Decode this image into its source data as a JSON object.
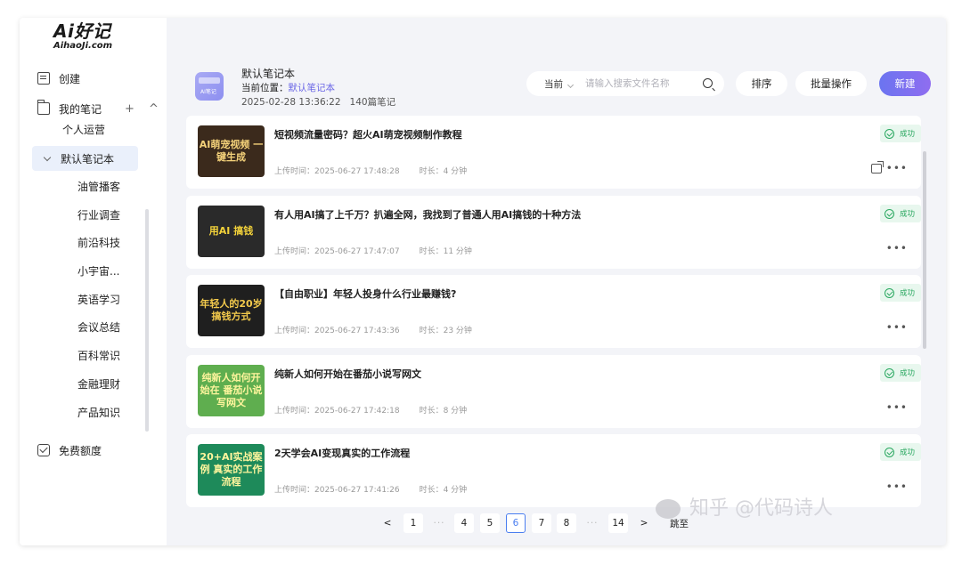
{
  "logo": {
    "main": "Ai好记",
    "sub": "AihaoJi.com"
  },
  "sidebar": {
    "create_label": "创建",
    "my_notes_label": "我的笔记",
    "my_notes_actions": "+ ^",
    "personal_ops": "个人运营",
    "default_notebook": "默认笔记本",
    "leaves": [
      "油管播客",
      "行业调查",
      "前沿科技",
      "小宇宙...",
      "英语学习",
      "会议总结",
      "百科常识",
      "金融理财",
      "产品知识"
    ],
    "quota_label": "免费额度"
  },
  "header": {
    "notebook_title": "默认笔记本",
    "location_prefix": "当前位置：",
    "location_link": "默认笔记本",
    "date": "2025-02-28 13:36:22",
    "count": "140篇笔记",
    "search_scope": "当前",
    "search_placeholder": "请输入搜索文件名称",
    "sort_label": "排序",
    "batch_label": "批量操作",
    "new_label": "新建"
  },
  "cards": [
    {
      "title": "短视频流量密码？超火AI萌宠视频制作教程",
      "upload": "上传时间：2025-06-27 17:48:28",
      "duration": "时长：4 分钟",
      "status": "成功",
      "thumb_text": "AI萌宠视频 一键生成",
      "thumb_bg": "#3b2a1c",
      "thumb_fg": "#f5d27a"
    },
    {
      "title": "有人用AI搞了上千万？扒遍全网，我找到了普通人用AI搞钱的十种方法",
      "upload": "上传时间：2025-06-27 17:47:07",
      "duration": "时长：11 分钟",
      "status": "成功",
      "thumb_text": "用AI 搞钱",
      "thumb_bg": "#2a2a2a",
      "thumb_fg": "#f3d23a"
    },
    {
      "title": "【自由职业】年轻人投身什么行业最赚钱?",
      "upload": "上传时间：2025-06-27 17:43:36",
      "duration": "时长：23 分钟",
      "status": "成功",
      "thumb_text": "年轻人的20岁 搞钱方式",
      "thumb_bg": "#1f1f1f",
      "thumb_fg": "#f2c94c"
    },
    {
      "title": "纯新人如何开始在番茄小说写网文",
      "upload": "上传时间：2025-06-27 17:42:18",
      "duration": "时长：8 分钟",
      "status": "成功",
      "thumb_text": "纯新人如何开始在 番茄小说写网文",
      "thumb_bg": "#5fae4f",
      "thumb_fg": "#fff59d"
    },
    {
      "title": "2天学会AI变现真实的工作流程",
      "upload": "上传时间：2025-06-27 17:41:26",
      "duration": "时长：4 分钟",
      "status": "成功",
      "thumb_text": "20+AI实战案例 真实的工作流程",
      "thumb_bg": "#1e8a5a",
      "thumb_fg": "#fff59d"
    }
  ],
  "pager": {
    "prev": "<",
    "next": ">",
    "pages": [
      "1",
      "···",
      "4",
      "5",
      "6",
      "7",
      "8",
      "···",
      "14"
    ],
    "active": "6",
    "jump_label": "跳至"
  },
  "watermark": "知乎 @代码诗人"
}
